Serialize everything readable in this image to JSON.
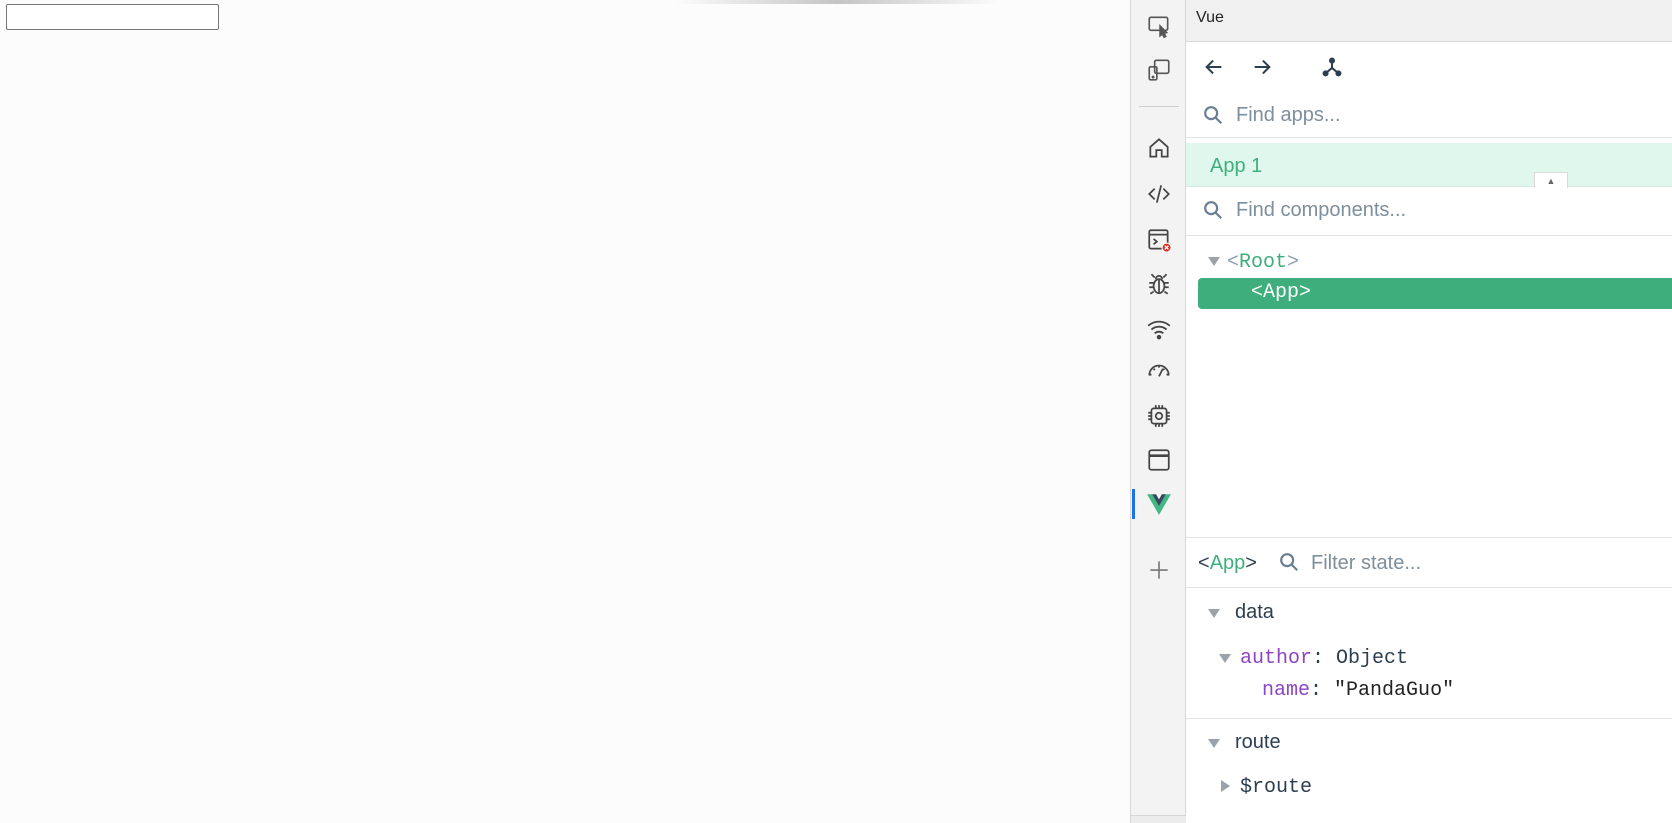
{
  "page": {
    "input_value": ""
  },
  "activity_bar": {
    "icons": [
      "inspect-element-icon",
      "device-toolbar-icon",
      "home-icon",
      "code-icon",
      "console-error-icon",
      "bug-icon",
      "network-wifi-icon",
      "performance-gauge-icon",
      "cpu-chip-icon",
      "browser-window-icon",
      "vue-logo-icon",
      "plus-icon"
    ],
    "active": "vue-logo-icon",
    "error_badge_color": "#d93025",
    "active_color": "#1a73e8"
  },
  "vue_panel": {
    "title": "Vue",
    "nav": {
      "back": "arrow-left-icon",
      "forward": "arrow-right-icon",
      "tree": "component-tree-icon"
    },
    "apps_search": {
      "placeholder": "Find apps..."
    },
    "app": {
      "label": "App 1"
    },
    "components_search": {
      "placeholder": "Find components..."
    },
    "tree": {
      "root": {
        "open": "<",
        "name": "Root",
        "close": ">"
      },
      "child": {
        "open": "<",
        "name": "App",
        "close": ">"
      }
    },
    "state": {
      "selected_tag": {
        "open": "<",
        "name": "App",
        "close": ">"
      },
      "filter_placeholder": "Filter state...",
      "sections": {
        "data": {
          "name": "data",
          "author_key": "author",
          "author_sep": ":",
          "author_type": "Object",
          "name_key": "name",
          "name_sep": ":",
          "name_value": "\"PandaGuo\""
        },
        "route": {
          "name": "route",
          "route_key": "$route"
        }
      }
    },
    "accent_color": "#3eaf7c"
  }
}
